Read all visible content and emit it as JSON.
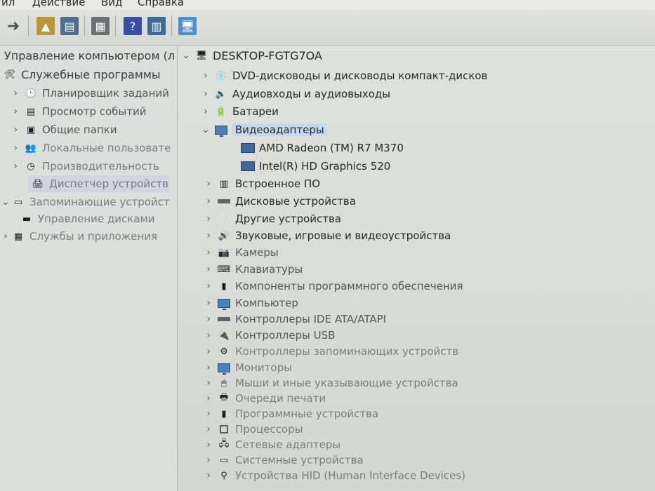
{
  "menu": {
    "items": [
      "ил",
      "Действие",
      "Вид",
      "Справка"
    ]
  },
  "toolbar": {
    "icons": [
      "back-arrow-icon",
      "folder-up-icon",
      "show-hide-tree-icon",
      "properties-icon",
      "help-icon",
      "action-pane-icon",
      "monitor-scan-icon"
    ]
  },
  "left_tree": {
    "items": [
      {
        "label": "Управление компьютером (л"
      },
      {
        "label": "Служебные программы"
      },
      {
        "label": "Планировщик заданий"
      },
      {
        "label": "Просмотр событий"
      },
      {
        "label": "Общие папки"
      },
      {
        "label": "Локальные пользовате"
      },
      {
        "label": "Производительность"
      },
      {
        "label": "Диспетчер устройств"
      },
      {
        "label": "Запоминающие устройст"
      },
      {
        "label": "Управление дисками"
      },
      {
        "label": "Службы и приложения"
      }
    ]
  },
  "device_tree": {
    "root": "DESKTOP-FGTG7OA",
    "categories": [
      {
        "label": "DVD-дисководы и дисководы компакт-дисков"
      },
      {
        "label": "Аудиовходы и аудиовыходы"
      },
      {
        "label": "Батареи"
      },
      {
        "label": "Видеоадаптеры",
        "expanded": true,
        "children": [
          {
            "label": "AMD Radeon (TM) R7 M370"
          },
          {
            "label": "Intel(R) HD Graphics 520"
          }
        ]
      },
      {
        "label": "Встроенное ПО"
      },
      {
        "label": "Дисковые устройства"
      },
      {
        "label": "Другие устройства"
      },
      {
        "label": "Звуковые, игровые и видеоустройства"
      },
      {
        "label": "Камеры"
      },
      {
        "label": "Клавиатуры"
      },
      {
        "label": "Компоненты программного обеспечения"
      },
      {
        "label": "Компьютер"
      },
      {
        "label": "Контроллеры IDE ATA/ATAPI"
      },
      {
        "label": "Контроллеры USB"
      },
      {
        "label": "Контроллеры запоминающих устройств"
      },
      {
        "label": "Мониторы"
      },
      {
        "label": "Мыши и иные указывающие устройства"
      },
      {
        "label": "Очереди печати"
      },
      {
        "label": "Программные устройства"
      },
      {
        "label": "Процессоры"
      },
      {
        "label": "Сетевые адаптеры"
      },
      {
        "label": "Системные устройства"
      },
      {
        "label": "Устройства HID (Human Interface Devices)"
      }
    ]
  }
}
